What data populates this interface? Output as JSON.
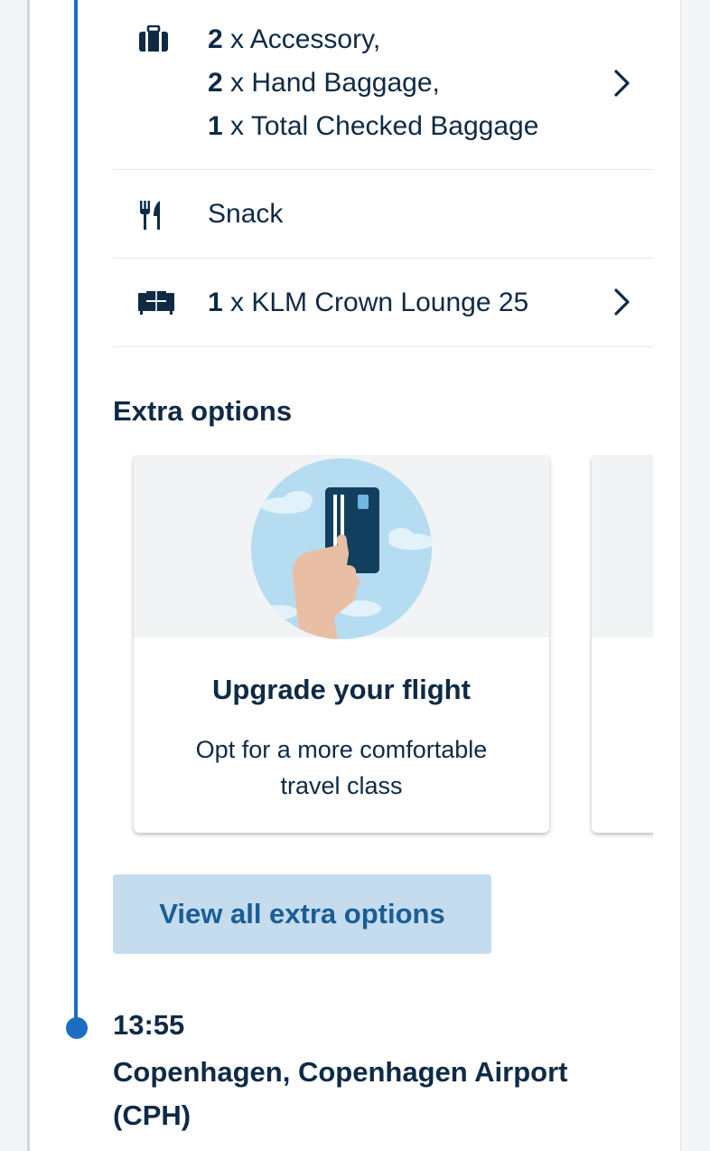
{
  "services": {
    "baggage": {
      "icon": "baggage-icon",
      "lines": [
        {
          "count": "2",
          "label": " x Accessory,"
        },
        {
          "count": "2",
          "label": " x Hand Baggage,"
        },
        {
          "count": "1",
          "label": " x Total Checked Baggage"
        }
      ]
    },
    "meal": {
      "icon": "cutlery-icon",
      "label": "Snack"
    },
    "lounge": {
      "icon": "lounge-sofa-icon",
      "count": "1",
      "label": " x KLM Crown Lounge 25"
    }
  },
  "extra_options": {
    "title": "Extra options",
    "cards": [
      {
        "title": "Upgrade your flight",
        "description": "Opt for a more comfortable travel class",
        "illustration": "hand-holding-card-icon"
      }
    ],
    "view_all_label": "View all extra options"
  },
  "arrival": {
    "time": "13:55",
    "place": "Copenhagen, Copenhagen Airport (CPH)"
  },
  "colors": {
    "primary": "#1b6ec2",
    "text": "#0e2a45",
    "button_bg": "#c4dcee",
    "button_text": "#1b5d95"
  }
}
